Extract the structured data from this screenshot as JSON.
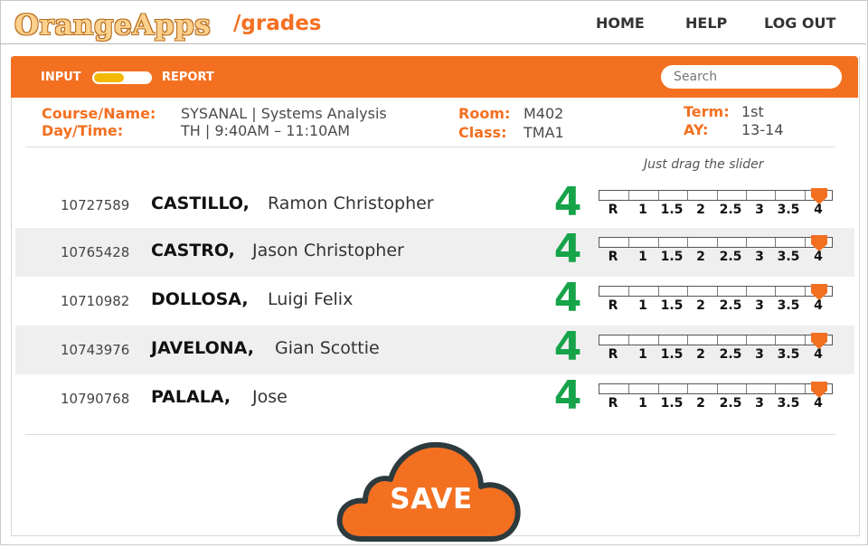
{
  "header": {
    "logo": "OrangeApps",
    "section": "/grades",
    "nav": [
      "HOME",
      "HELP",
      "LOG OUT"
    ]
  },
  "toolbar": {
    "mode_left": "INPUT",
    "mode_right": "REPORT",
    "search_placeholder": "Search"
  },
  "course_info": {
    "course_label": "Course/Name:",
    "course_value": "SYSANAL | Systems Analysis",
    "daytime_label": "Day/Time:",
    "daytime_value": "TH | 9:40AM – 11:10AM",
    "room_label": "Room:",
    "room_value": "M402",
    "class_label": "Class:",
    "class_value": "TMA1",
    "term_label": "Term:",
    "term_value": "1st",
    "ay_label": "AY:",
    "ay_value": "13-14"
  },
  "hint": "Just drag the slider",
  "grade_scale": [
    "R",
    "1",
    "1.5",
    "2",
    "2.5",
    "3",
    "3.5",
    "4"
  ],
  "students": [
    {
      "id": "10727589",
      "last": "CASTILLO,",
      "first": "Ramon Christopher",
      "grade": "4"
    },
    {
      "id": "10765428",
      "last": "CASTRO,",
      "first": "Jason Christopher",
      "grade": "4"
    },
    {
      "id": "10710982",
      "last": "DOLLOSA,",
      "first": "Luigi Felix",
      "grade": "4"
    },
    {
      "id": "10743976",
      "last": "JAVELONA,",
      "first": "Gian Scottie",
      "grade": "4"
    },
    {
      "id": "10790768",
      "last": "PALALA,",
      "first": "Jose",
      "grade": "4"
    }
  ],
  "save_label": "SAVE",
  "colors": {
    "accent": "#f37021",
    "grade_green": "#16a34a",
    "toggle_knob": "#f5b800",
    "cloud_border": "#2d3b3f"
  }
}
